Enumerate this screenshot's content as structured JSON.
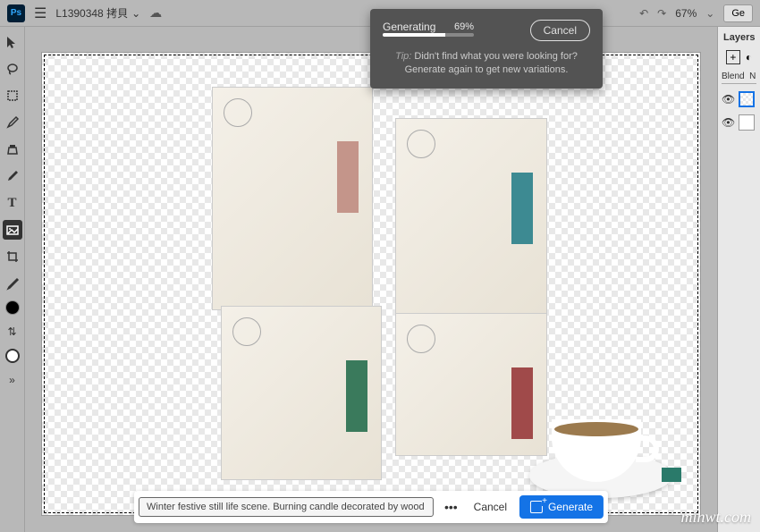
{
  "topbar": {
    "logo_text": "Ps",
    "doc_title": "L1390348 拷貝",
    "undo_icon": "↶",
    "redo_icon": "↷",
    "zoom": "67%",
    "gen_button": "Ge"
  },
  "progress": {
    "title": "Generating",
    "percent_text": "69%",
    "percent_value": 69,
    "cancel": "Cancel",
    "tip_label": "Tip:",
    "tip_text": "Didn't find what you were looking for? Generate again to get new variations."
  },
  "taskbar": {
    "prompt": "Winter festive still life scene. Burning candle decorated by wood…",
    "more": "•••",
    "cancel": "Cancel",
    "generate": "Generate"
  },
  "layers": {
    "title": "Layers",
    "blend_label": "Blend",
    "blend_value": "N"
  },
  "watermark": "minwt.com"
}
